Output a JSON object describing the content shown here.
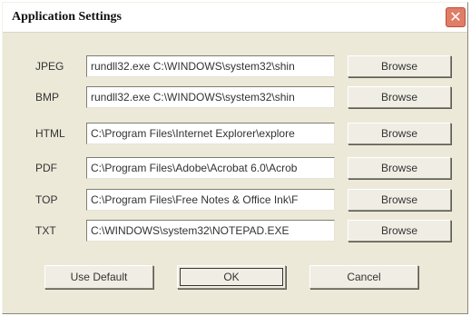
{
  "dialog": {
    "title": "Application Settings",
    "close_glyph": "✕"
  },
  "rows": [
    {
      "label": "JPEG",
      "path": "rundll32.exe C:\\WINDOWS\\system32\\shin",
      "browse_label": "Browse"
    },
    {
      "label": "BMP",
      "path": "rundll32.exe C:\\WINDOWS\\system32\\shin",
      "browse_label": "Browse"
    },
    {
      "label": "HTML",
      "path": "C:\\Program Files\\Internet Explorer\\explore",
      "browse_label": "Browse"
    },
    {
      "label": "PDF",
      "path": "C:\\Program Files\\Adobe\\Acrobat 6.0\\Acrob",
      "browse_label": "Browse"
    },
    {
      "label": "TOP",
      "path": "C:\\Program Files\\Free Notes & Office Ink\\F",
      "browse_label": "Browse"
    },
    {
      "label": "TXT",
      "path": "C:\\WINDOWS\\system32\\NOTEPAD.EXE",
      "browse_label": "Browse"
    }
  ],
  "footer": {
    "use_default_label": "Use Default",
    "ok_label": "OK",
    "cancel_label": "Cancel"
  },
  "colors": {
    "dialog_bg": "#ece9d8",
    "close_button": "#e07d67"
  }
}
